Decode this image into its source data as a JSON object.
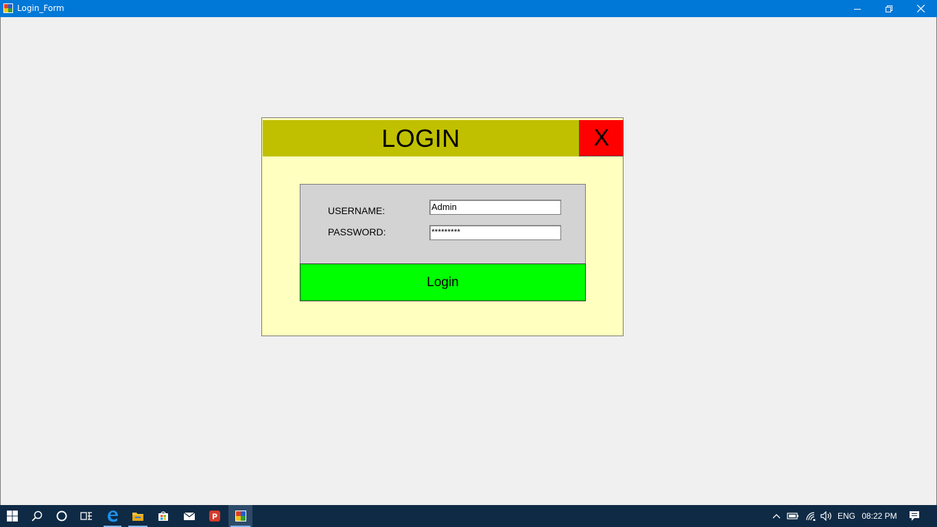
{
  "window": {
    "title": "Login_Form",
    "controls": {
      "minimize": "minimize",
      "maximize": "restore",
      "close": "close"
    }
  },
  "login_panel": {
    "heading": "LOGIN",
    "close_label": "X",
    "username_label": "USERNAME:",
    "password_label": "PASSWORD:",
    "username_value": "Admin",
    "password_value": "*********",
    "login_button_label": "Login"
  },
  "colors": {
    "titlebar": "#0078d7",
    "panel_background": "#ffffc0",
    "header_background": "#c0c000",
    "close_background": "#ff0000",
    "form_background": "#d3d3d3",
    "login_button": "#00ff00"
  },
  "taskbar": {
    "items": [
      "start-icon",
      "search-icon",
      "cortana-icon",
      "task-view-icon",
      "edge-icon",
      "file-explorer-icon",
      "store-icon",
      "mail-icon",
      "app-p-icon",
      "login-form-app-icon"
    ],
    "tray": {
      "language": "ENG",
      "time": "08:22 PM"
    }
  }
}
